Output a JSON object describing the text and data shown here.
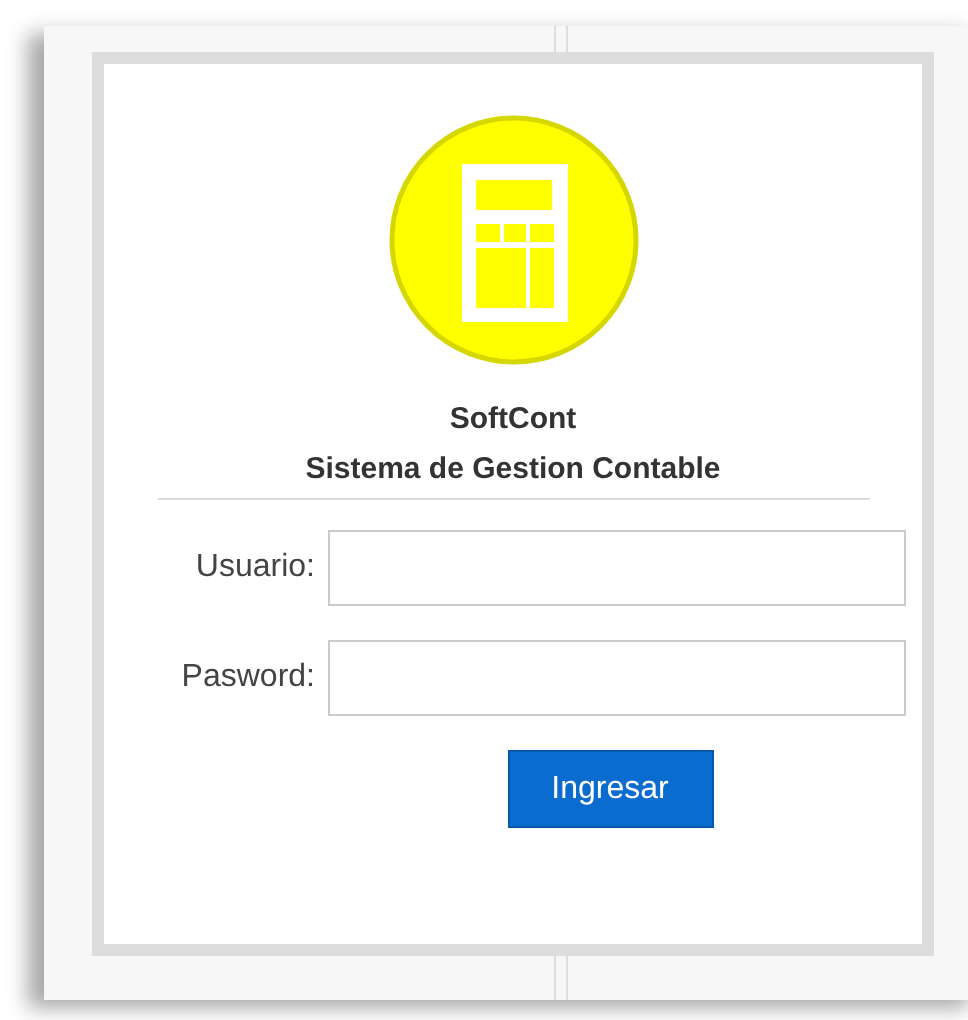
{
  "app": {
    "name": "SoftCont",
    "subtitle": "Sistema de Gestion Contable"
  },
  "fields": [
    {
      "label": "Usuario:"
    },
    {
      "label": "Pasword:"
    }
  ],
  "button": {
    "label": "Ingresar"
  }
}
